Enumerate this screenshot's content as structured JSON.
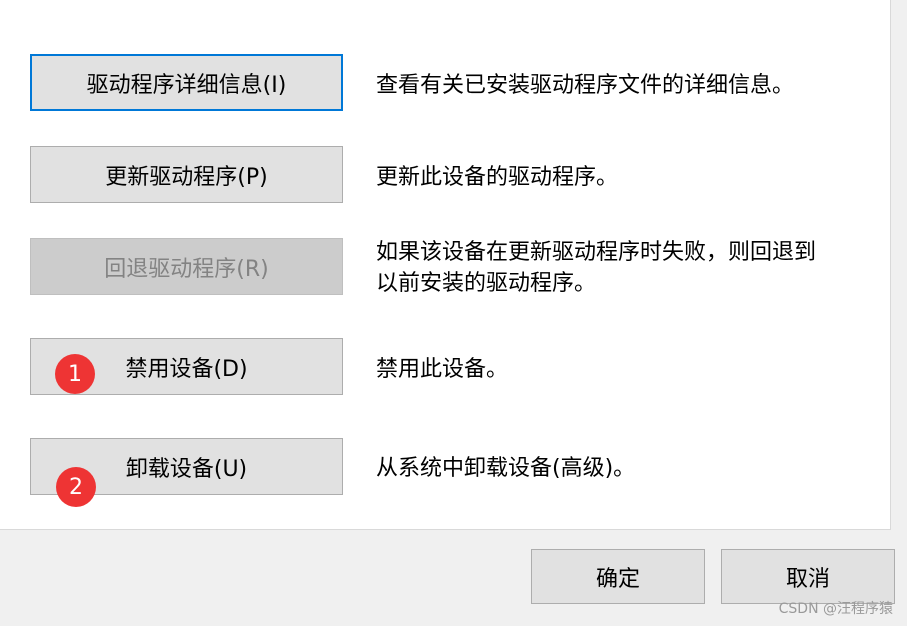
{
  "actions": [
    {
      "button_label": "驱动程序详细信息(I)",
      "description": [
        "查看有关已安装驱动程序文件的详细信息。"
      ],
      "state": "focused"
    },
    {
      "button_label": "更新驱动程序(P)",
      "description": [
        "更新此设备的驱动程序。"
      ],
      "state": "normal"
    },
    {
      "button_label": "回退驱动程序(R)",
      "description": [
        "如果该设备在更新驱动程序时失败，则回退到",
        "以前安装的驱动程序。"
      ],
      "state": "disabled"
    },
    {
      "button_label": "禁用设备(D)",
      "description": [
        "禁用此设备。"
      ],
      "state": "normal"
    },
    {
      "button_label": "卸载设备(U)",
      "description": [
        "从系统中卸载设备(高级)。"
      ],
      "state": "normal"
    }
  ],
  "markers": [
    "1",
    "2"
  ],
  "footer": {
    "ok_label": "确定",
    "cancel_label": "取消"
  },
  "watermark": "CSDN @汪程序猿",
  "colors": {
    "focus_border": "#0078d7",
    "button_bg": "#e1e1e1",
    "disabled_bg": "#cccccc",
    "marker": "#ee3434"
  }
}
